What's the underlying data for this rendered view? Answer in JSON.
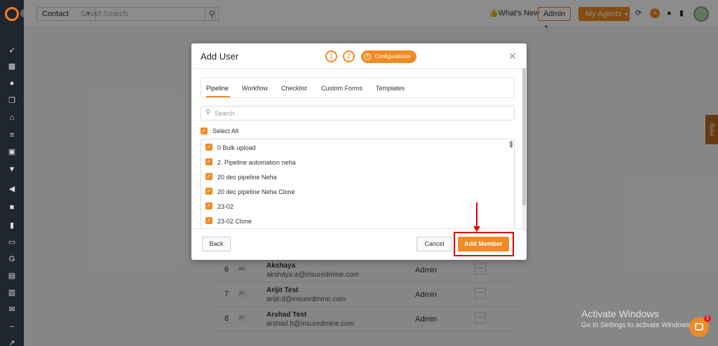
{
  "topbar": {
    "contact_label": "Contact",
    "search_placeholder": "Smart Search",
    "whats_new": "What's New",
    "admin_label": "Admin",
    "agents_label": "My Agents"
  },
  "rail": {
    "icons": [
      "rocket-icon",
      "dashboard-icon",
      "users-icon",
      "copy-icon",
      "bank-icon",
      "list-icon",
      "contact-card-icon",
      "funnel-icon",
      "megaphone-icon",
      "document-icon",
      "chart-icon",
      "folder-icon",
      "google-icon",
      "calendar-doc-icon",
      "calendar-icon",
      "mail-icon",
      "signature-icon",
      "trend-icon"
    ]
  },
  "background_rows": [
    {
      "num": "6",
      "initials": "AK",
      "name": "Akshaya",
      "email": "akshaya.a@insuredmine.com",
      "role": "Admin"
    },
    {
      "num": "7",
      "initials": "AT",
      "name": "Arijit Test",
      "email": "arijit.d@insuredmine.com",
      "role": "Admin"
    },
    {
      "num": "8",
      "initials": "AT",
      "name": "Arshad Test",
      "email": "arshad.b@insuredmine.com",
      "role": "Admin"
    }
  ],
  "help_label": "Help",
  "modal": {
    "title": "Add User",
    "steps": [
      "1",
      "2"
    ],
    "active_step_num": "3",
    "active_step_label": "Configurations",
    "tabs": [
      "Pipeline",
      "Workflow",
      "Checklist",
      "Custom Forms",
      "Templates"
    ],
    "active_tab": "Pipeline",
    "search_placeholder": "Search",
    "select_all_label": "Select All",
    "pipelines": [
      "0 Bulk upload",
      "2. Pipeline automation neha",
      "20 dec pipeline Neha",
      "20 dec pipeline Neha Clone",
      "23-02",
      "23-02 Clone"
    ],
    "back_label": "Back",
    "cancel_label": "Cancel",
    "add_member_label": "Add Member"
  },
  "windows": {
    "line1": "Activate Windows",
    "line2": "Go to Settings to activate Windows."
  },
  "chat_badge": "1",
  "colors": {
    "accent": "#f08a24",
    "rail_bg": "#20262d",
    "annotation": "#e00000"
  }
}
